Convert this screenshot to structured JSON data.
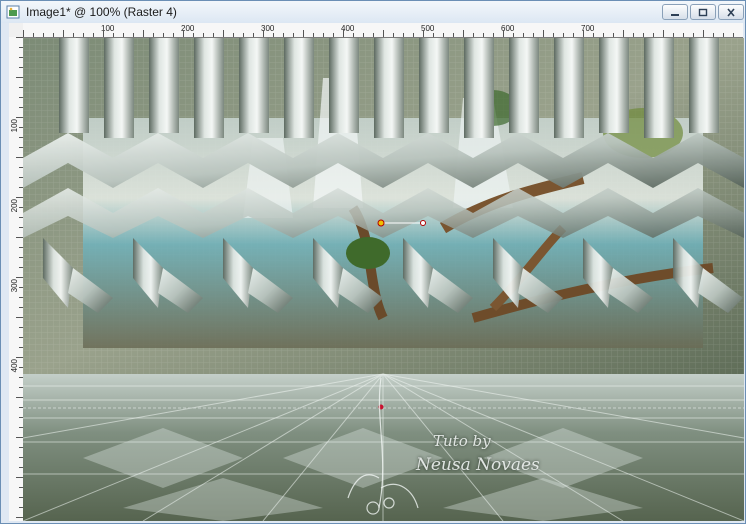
{
  "window": {
    "title": "Image1* @ 100% (Raster 4)",
    "minimize_icon": "minimize-icon",
    "maximize_icon": "maximize-icon",
    "close_icon": "close-icon"
  },
  "rulers": {
    "horizontal_labels": [
      "100",
      "200",
      "300",
      "400",
      "500",
      "600",
      "700"
    ],
    "vertical_labels": [
      "100",
      "200",
      "300",
      "400"
    ]
  },
  "canvas": {
    "description_icons": [
      "ribbon-weave",
      "waterfall-scene",
      "checker-floor",
      "floral-ornament"
    ],
    "watermark_line1": "Tuto by",
    "watermark_line2": "Neusa Novaes"
  },
  "colors": {
    "ribbon_light": "#dfe6e2",
    "ribbon_dark": "#5d6a61",
    "floor_dark": "#56644f",
    "floor_light": "#e4ebe8",
    "water": "#6fb3bd"
  }
}
